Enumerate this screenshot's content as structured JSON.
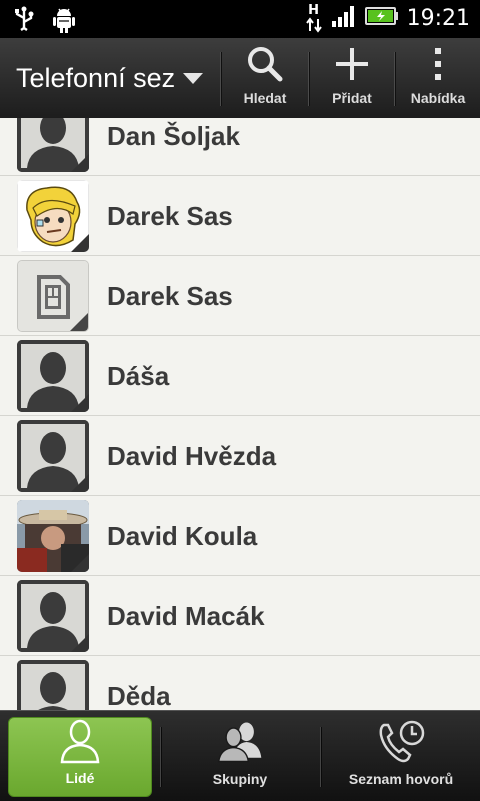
{
  "status_bar": {
    "time": "19:21",
    "network_type": "H",
    "icons": [
      "usb-icon",
      "android-debug-icon",
      "data-arrows-icon",
      "signal-icon",
      "battery-charging-icon"
    ]
  },
  "action_bar": {
    "title": "Telefonní sez",
    "buttons": [
      {
        "label": "Hledat",
        "icon": "search-icon"
      },
      {
        "label": "Přidat",
        "icon": "plus-icon"
      },
      {
        "label": "Nabídka",
        "icon": "menu-dots-icon"
      }
    ]
  },
  "contacts": [
    {
      "name": "Dan Šoljak",
      "avatar": "default-person"
    },
    {
      "name": "Darek Sas",
      "avatar": "cartoon-photo"
    },
    {
      "name": "Darek Sas",
      "avatar": "sim-card"
    },
    {
      "name": "Dáša",
      "avatar": "default-person"
    },
    {
      "name": "David Hvězda",
      "avatar": "default-person"
    },
    {
      "name": "David Koula",
      "avatar": "photo"
    },
    {
      "name": "David Macák",
      "avatar": "default-person"
    },
    {
      "name": "Děda",
      "avatar": "default-person"
    }
  ],
  "tabs": [
    {
      "label": "Lidé",
      "icon": "person-icon",
      "active": true
    },
    {
      "label": "Skupiny",
      "icon": "groups-icon",
      "active": false
    },
    {
      "label": "Seznam hovorů",
      "icon": "call-history-icon",
      "active": false
    }
  ],
  "colors": {
    "accent_green": "#7ab842",
    "bar_dark": "#1d1d1d",
    "list_bg": "#f3f3ef",
    "battery_green": "#58c21e"
  }
}
